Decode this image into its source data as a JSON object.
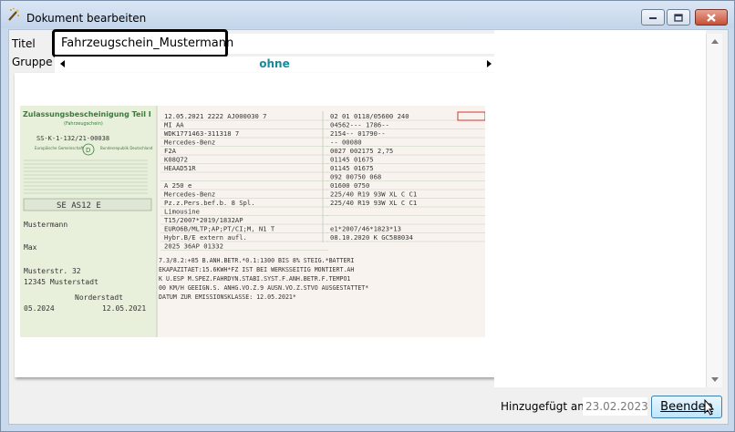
{
  "window": {
    "title": "Dokument bearbeiten"
  },
  "form": {
    "titel_label": "Titel",
    "titel_value": "Fahrzeugschein_Mustermann",
    "gruppe_label": "Gruppe",
    "gruppe_value": "ohne"
  },
  "footer": {
    "added_label": "Hinzugefügt am",
    "added_value": "23.02.2023",
    "end_button": "Beenden"
  },
  "document": {
    "heading": "Zulassungsbescheinigung Teil I",
    "sub_heading": "(Fahrzeugschein)",
    "serial": "SS-K-1-132/21-00038",
    "country_left": "Europäische Gemeinschaft",
    "country_code": "D",
    "country_right": "Bundesrepublik Deutschland",
    "plate": "SE AS12 E",
    "name": "Mustermann",
    "firstname": "Max",
    "street": "Musterstr. 32",
    "city": "12345 Musterstadt",
    "issue_place": "Norderstadt",
    "valid_until": "05.2024",
    "issue_date": "12.05.2021",
    "col_a": [
      "12.05.2021  2222  AJ000030 7",
      "MI         AA",
      "WDK1771463-311318  7",
      "Mercedes-Benz",
      "F2A",
      "K08Q72",
      "HEAAD51R",
      "",
      "A 250 e",
      "Mercedes-Benz",
      "Pz.z.Pers.bef.b. 8 Spl.",
      "Limousine",
      "T15/2007*2019/1832AP",
      "EURO6B/MLTP;AP;PT/CI;M, N1 T",
      "Hybr.B/E extern aufl.",
      "2025    36AP   01332"
    ],
    "col_b": [
      "02    01  0118/05600  240",
      "04562---      1786--",
      "2154--        01790--",
      "--      00080",
      "0027    002175   2,75",
      "01145   01675",
      "01145   01675",
      "092     00750    068",
      "01600   0750",
      "225/40 R19 93W XL C C1",
      "225/40 R19 93W XL C C1",
      "",
      "",
      "e1*2007/46*1823*13",
      "08.10.2020   K   GC588034"
    ],
    "remarks": [
      "7.3/8.2:+85 B.ANH.BETR.*0.1:1300 BIS 8% STEIG.*BATTERI",
      "EKAPAZITAET:15.6KWH*FZ IST BEI WERKSSEITIG MONTIERT.AH",
      "K U.ESP M.SPEZ.FAHRDYN.STABI.SYST.F.ANH.BETR.F.TEMPO1",
      "00 KM/H GEEIGN.S. ANHG.VO.Z.9 AUSN.VO.Z.STVO AUSGESTATTET*",
      "DATUM ZUR EMISSIONSKLASSE: 12.05.2021*"
    ]
  },
  "icons": {
    "app": "magic-wand-icon",
    "minimize": "minimize-icon",
    "maximize": "maximize-icon",
    "close": "close-icon",
    "prev": "arrow-left-icon",
    "next": "arrow-right-icon",
    "cursor": "mouse-cursor-icon"
  },
  "colors": {
    "accent": "#198a9a",
    "close": "#c75037",
    "doc_green": "#3c7a3c",
    "doc_red": "#d02020"
  }
}
